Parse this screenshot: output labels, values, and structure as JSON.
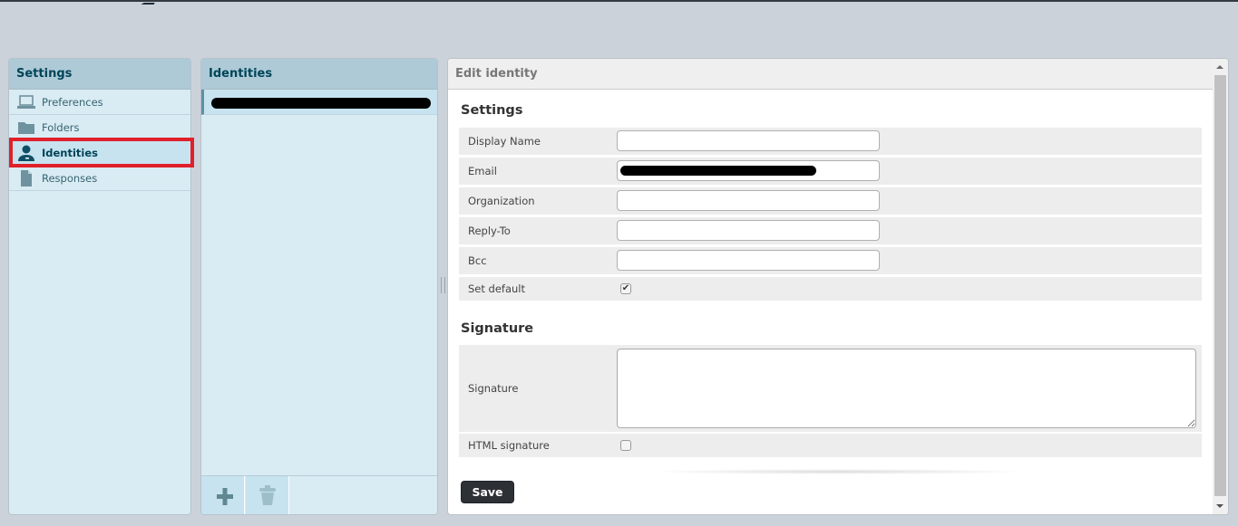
{
  "settings_panel": {
    "title": "Settings",
    "items": [
      {
        "label": "Preferences",
        "icon": "laptop-icon",
        "selected": false
      },
      {
        "label": "Folders",
        "icon": "folder-icon",
        "selected": false
      },
      {
        "label": "Identities",
        "icon": "user-icon",
        "selected": true
      },
      {
        "label": "Responses",
        "icon": "document-icon",
        "selected": false
      }
    ]
  },
  "identities_panel": {
    "title": "Identities",
    "items": [
      {
        "label": "[redacted]",
        "selected": true
      }
    ],
    "footer": {
      "add_icon": "plus-icon",
      "delete_icon": "trash-icon"
    }
  },
  "edit_panel": {
    "title": "Edit identity",
    "settings_section": {
      "title": "Settings",
      "fields": [
        {
          "label": "Display Name",
          "value": ""
        },
        {
          "label": "Email",
          "value": "[redacted]"
        },
        {
          "label": "Organization",
          "value": ""
        },
        {
          "label": "Reply-To",
          "value": ""
        },
        {
          "label": "Bcc",
          "value": ""
        }
      ],
      "set_default": {
        "label": "Set default",
        "checked": true
      }
    },
    "signature_section": {
      "title": "Signature",
      "signature": {
        "label": "Signature",
        "value": ""
      },
      "html_signature": {
        "label": "HTML signature",
        "checked": false
      }
    },
    "save_label": "Save"
  },
  "colors": {
    "highlight": "#e0202a",
    "panel_header": "#adcad6",
    "panel_bg": "#d9ebf3",
    "header_text": "#004458",
    "save_button": "#2d3136"
  }
}
